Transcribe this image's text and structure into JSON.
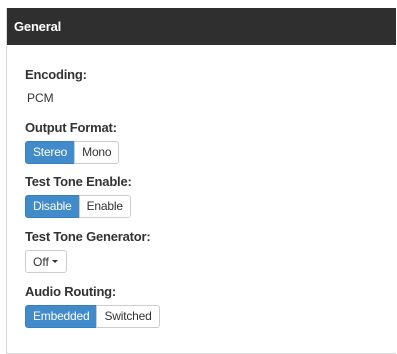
{
  "panel": {
    "title": "General"
  },
  "encoding": {
    "label": "Encoding:",
    "value": "PCM"
  },
  "output_format": {
    "label": "Output Format:",
    "options": [
      "Stereo",
      "Mono"
    ],
    "selected": "Stereo"
  },
  "test_tone_enable": {
    "label": "Test Tone Enable:",
    "options": [
      "Disable",
      "Enable"
    ],
    "selected": "Disable"
  },
  "test_tone_generator": {
    "label": "Test Tone Generator:",
    "value": "Off",
    "icon": "chevron-down-icon"
  },
  "audio_routing": {
    "label": "Audio Routing:",
    "options": [
      "Embedded",
      "Switched"
    ],
    "selected": "Embedded"
  },
  "colors": {
    "header_bg": "#2f2f2f",
    "accent": "#428bca"
  }
}
